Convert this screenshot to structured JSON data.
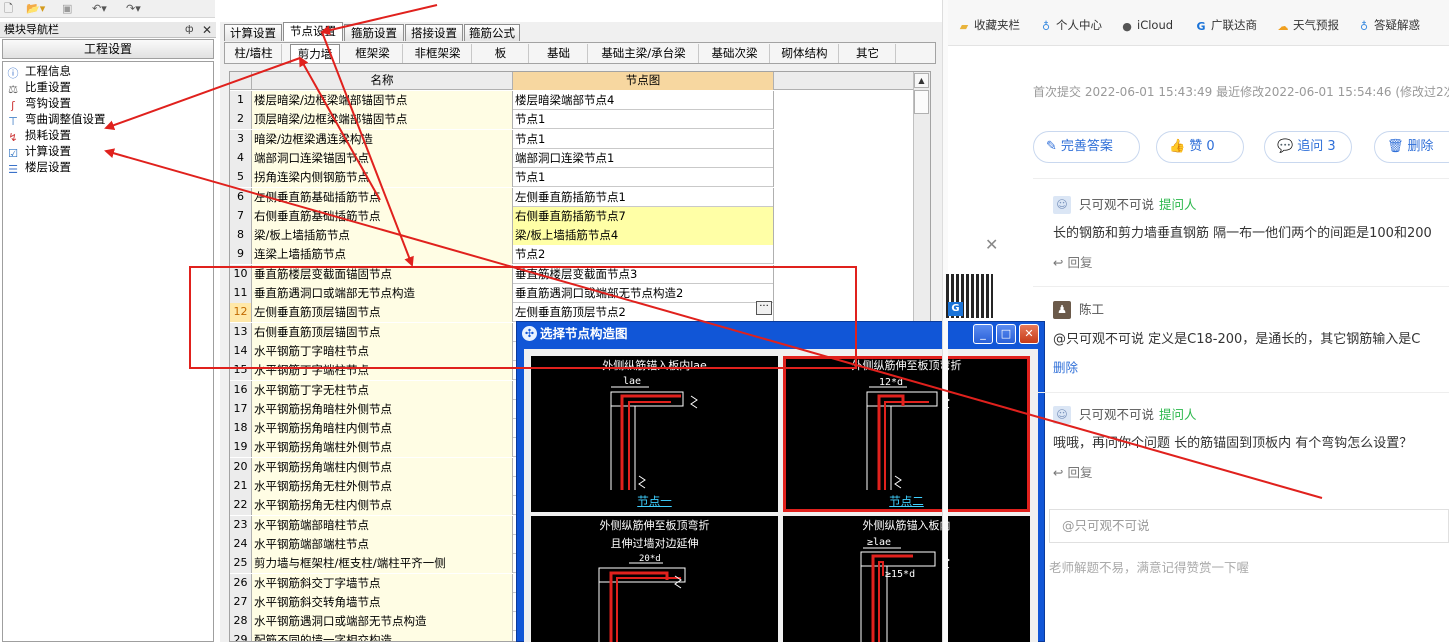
{
  "toolbar": {
    "icons": [
      "new-file-icon",
      "open-folder-icon",
      "save-icon",
      "undo-icon",
      "redo-icon"
    ]
  },
  "nav": {
    "title": "模块导航栏",
    "pin": "ф",
    "close": "✕",
    "section_button": "工程设置",
    "items": [
      {
        "label": "工程信息",
        "icon": "info-icon"
      },
      {
        "label": "比重设置",
        "icon": "weight-icon"
      },
      {
        "label": "弯钩设置",
        "icon": "hook-icon"
      },
      {
        "label": "弯曲调整值设置",
        "icon": "bend-icon"
      },
      {
        "label": "损耗设置",
        "icon": "loss-icon"
      },
      {
        "label": "计算设置",
        "icon": "calc-icon"
      },
      {
        "label": "楼层设置",
        "icon": "floor-icon"
      }
    ]
  },
  "top_tabs": [
    "计算设置",
    "节点设置",
    "箍筋设置",
    "搭接设置",
    "箍筋公式"
  ],
  "top_tab_active": 1,
  "sub_tabs": [
    "柱/墙柱",
    "剪力墙",
    "框架梁",
    "非框架梁",
    "板",
    "基础",
    "基础主梁/承台梁",
    "基础次梁",
    "砌体结构",
    "其它"
  ],
  "sub_tab_active": 1,
  "grid": {
    "col_name": "名称",
    "col_node": "节点图",
    "rows": [
      {
        "n": "1",
        "name": "楼层暗梁/边框梁端部锚固节点",
        "node": "楼层暗梁端部节点4"
      },
      {
        "n": "2",
        "name": "顶层暗梁/边框梁端部锚固节点",
        "node": "节点1"
      },
      {
        "n": "3",
        "name": "暗梁/边框梁遇连梁构造",
        "node": "节点1"
      },
      {
        "n": "4",
        "name": "端部洞口连梁锚固节点",
        "node": "端部洞口连梁节点1"
      },
      {
        "n": "5",
        "name": "拐角连梁内侧钢筋节点",
        "node": "节点1"
      },
      {
        "n": "6",
        "name": "左侧垂直筋基础插筋节点",
        "node": "左侧垂直筋插筋节点1"
      },
      {
        "n": "7",
        "name": "右侧垂直筋基础插筋节点",
        "node": "右侧垂直筋插筋节点7"
      },
      {
        "n": "8",
        "name": "梁/板上墙插筋节点",
        "node": "梁/板上墙插筋节点4"
      },
      {
        "n": "9",
        "name": "连梁上墙插筋节点",
        "node": "节点2"
      },
      {
        "n": "10",
        "name": "垂直筋楼层变截面锚固节点",
        "node": "垂直筋楼层变截面节点3"
      },
      {
        "n": "11",
        "name": "垂直筋遇洞口或端部无节点构造",
        "node": "垂直筋遇洞口或端部无节点构造2"
      },
      {
        "n": "12",
        "name": "左侧垂直筋顶层锚固节点",
        "node": "左侧垂直筋顶层节点2"
      },
      {
        "n": "13",
        "name": "右侧垂直筋顶层锚固节点",
        "node": ""
      },
      {
        "n": "14",
        "name": "水平钢筋丁字暗柱节点",
        "node": ""
      },
      {
        "n": "15",
        "name": "水平钢筋丁字端柱节点",
        "node": ""
      },
      {
        "n": "16",
        "name": "水平钢筋丁字无柱节点",
        "node": ""
      },
      {
        "n": "17",
        "name": "水平钢筋拐角暗柱外侧节点",
        "node": ""
      },
      {
        "n": "18",
        "name": "水平钢筋拐角暗柱内侧节点",
        "node": ""
      },
      {
        "n": "19",
        "name": "水平钢筋拐角端柱外侧节点",
        "node": ""
      },
      {
        "n": "20",
        "name": "水平钢筋拐角端柱内侧节点",
        "node": ""
      },
      {
        "n": "21",
        "name": "水平钢筋拐角无柱外侧节点",
        "node": ""
      },
      {
        "n": "22",
        "name": "水平钢筋拐角无柱内侧节点",
        "node": ""
      },
      {
        "n": "23",
        "name": "水平钢筋端部暗柱节点",
        "node": ""
      },
      {
        "n": "24",
        "name": "水平钢筋端部端柱节点",
        "node": ""
      },
      {
        "n": "25",
        "name": "剪力墙与框架柱/框支柱/端柱平齐一侧",
        "node": ""
      },
      {
        "n": "26",
        "name": "水平钢筋斜交丁字墙节点",
        "node": ""
      },
      {
        "n": "27",
        "name": "水平钢筋斜交转角墙节点",
        "node": ""
      },
      {
        "n": "28",
        "name": "水平钢筋遇洞口或端部无节点构造",
        "node": ""
      },
      {
        "n": "29",
        "name": "配筋不同的墙一字相交构造",
        "node": ""
      }
    ],
    "highlight_rows": [
      7,
      8
    ],
    "selected_row": 12,
    "ellipsis": "···"
  },
  "dialog": {
    "title": "选择节点构造图",
    "min": "_",
    "max": "□",
    "close": "✕",
    "panels": [
      {
        "title": "外侧纵筋锚入板内lae",
        "dim": "lae",
        "label": "节点一",
        "selected": false
      },
      {
        "title": "外侧纵筋伸至板顶弯折",
        "dim": "12*d",
        "label": "节点二",
        "selected": true
      },
      {
        "title": "外侧纵筋伸至板顶弯折",
        "title2": "且伸过墙对边延伸",
        "dim": "20*d",
        "label": "",
        "selected": false
      },
      {
        "title": "外侧纵筋锚入板内",
        "dim": "≥lae",
        "dim2": "≥15*d",
        "label": "",
        "selected": false
      }
    ]
  },
  "bookmarks": [
    {
      "label": "收藏夹栏",
      "icon": "folder-icon",
      "color": "#e9b43b"
    },
    {
      "label": "个人中心",
      "icon": "bulb-icon",
      "color": "#3a8be0"
    },
    {
      "label": "iCloud",
      "icon": "apple-icon",
      "color": "#555555"
    },
    {
      "label": "广联达商",
      "icon": "g-logo-icon",
      "color": "#1a73d8"
    },
    {
      "label": "天气预报",
      "icon": "weather-icon",
      "color": "#f0a020"
    },
    {
      "label": "答疑解惑",
      "icon": "bulb-icon",
      "color": "#3a8be0"
    }
  ],
  "qa": {
    "meta": "首次提交 2022-06-01 15:43:49   最近修改2022-06-01 15:54:46 (修改过2次)",
    "actions": [
      {
        "label": "完善答案",
        "icon": "edit-icon"
      },
      {
        "label": "赞 0",
        "icon": "thumb-up-icon"
      },
      {
        "label": "追问  3",
        "icon": "comment-icon"
      },
      {
        "label": "删除",
        "icon": "trash-icon"
      }
    ],
    "comments": [
      {
        "user": "只可观不可说",
        "tag": "提问人",
        "text": "长的钢筋和剪力墙垂直钢筋 隔一布一他们两个的间距是100和200",
        "action": "回复"
      },
      {
        "user": "陈工",
        "tag": "",
        "text": "@只可观不可说  定义是C18-200，是通长的，其它钢筋输入是C",
        "action": "删除"
      },
      {
        "user": "只可观不可说",
        "tag": "提问人",
        "text": "哦哦，再问你个问题 长的筋锚固到顶板内 有个弯钩怎么设置？",
        "action": "回复"
      }
    ],
    "input_placeholder": "@只可观不可说",
    "hint": "老师解题不易，满意记得赞赏一下喔"
  },
  "colors": {
    "annotation_red": "#e0211d",
    "dialog_blue": "#1156d7",
    "link_blue": "#2f6fd8",
    "asker_green": "#2db84d"
  }
}
